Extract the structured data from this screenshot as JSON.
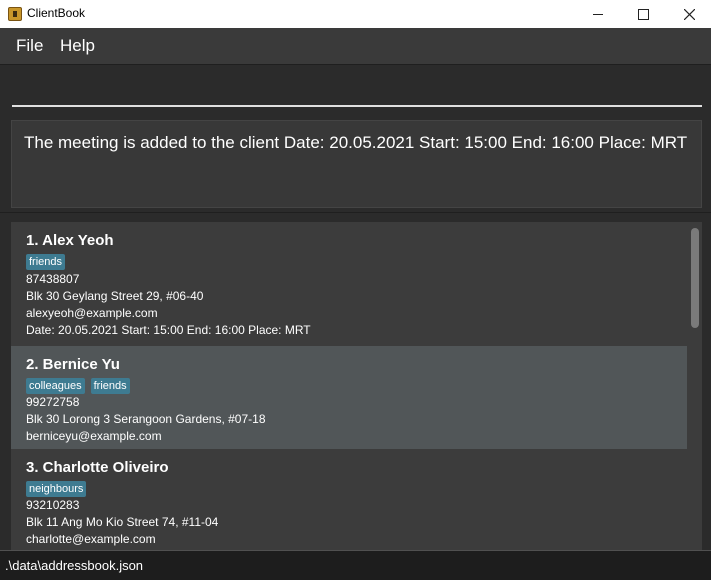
{
  "window": {
    "title": "ClientBook",
    "icon": "app-icon"
  },
  "menu": {
    "file": "File",
    "help": "Help"
  },
  "command_box": {
    "value": "",
    "placeholder": ""
  },
  "result": {
    "message": "The meeting is added to the client Date: 20.05.2021  Start: 15:00  End: 16:00  Place: MRT"
  },
  "clients": [
    {
      "name": "1.  Alex Yeoh",
      "tags": [
        "friends"
      ],
      "phone": "87438807",
      "address": "Blk 30 Geylang Street 29, #06-40",
      "email": "alexyeoh@example.com",
      "meeting": "Date: 20.05.2021  Start: 15:00  End: 16:00  Place: MRT"
    },
    {
      "name": "2.  Bernice Yu",
      "tags": [
        "colleagues",
        "friends"
      ],
      "phone": "99272758",
      "address": "Blk 30 Lorong 3 Serangoon Gardens, #07-18",
      "email": "berniceyu@example.com"
    },
    {
      "name": "3.  Charlotte Oliveiro",
      "tags": [
        "neighbours"
      ],
      "phone": "93210283",
      "address": "Blk 11 Ang Mo Kio Street 74, #11-04",
      "email": "charlotte@example.com"
    }
  ],
  "status": {
    "path": ".\\data\\addressbook.json"
  },
  "colors": {
    "background": "#383838",
    "tag": "#3e7b91",
    "selected_card": "#515658"
  }
}
